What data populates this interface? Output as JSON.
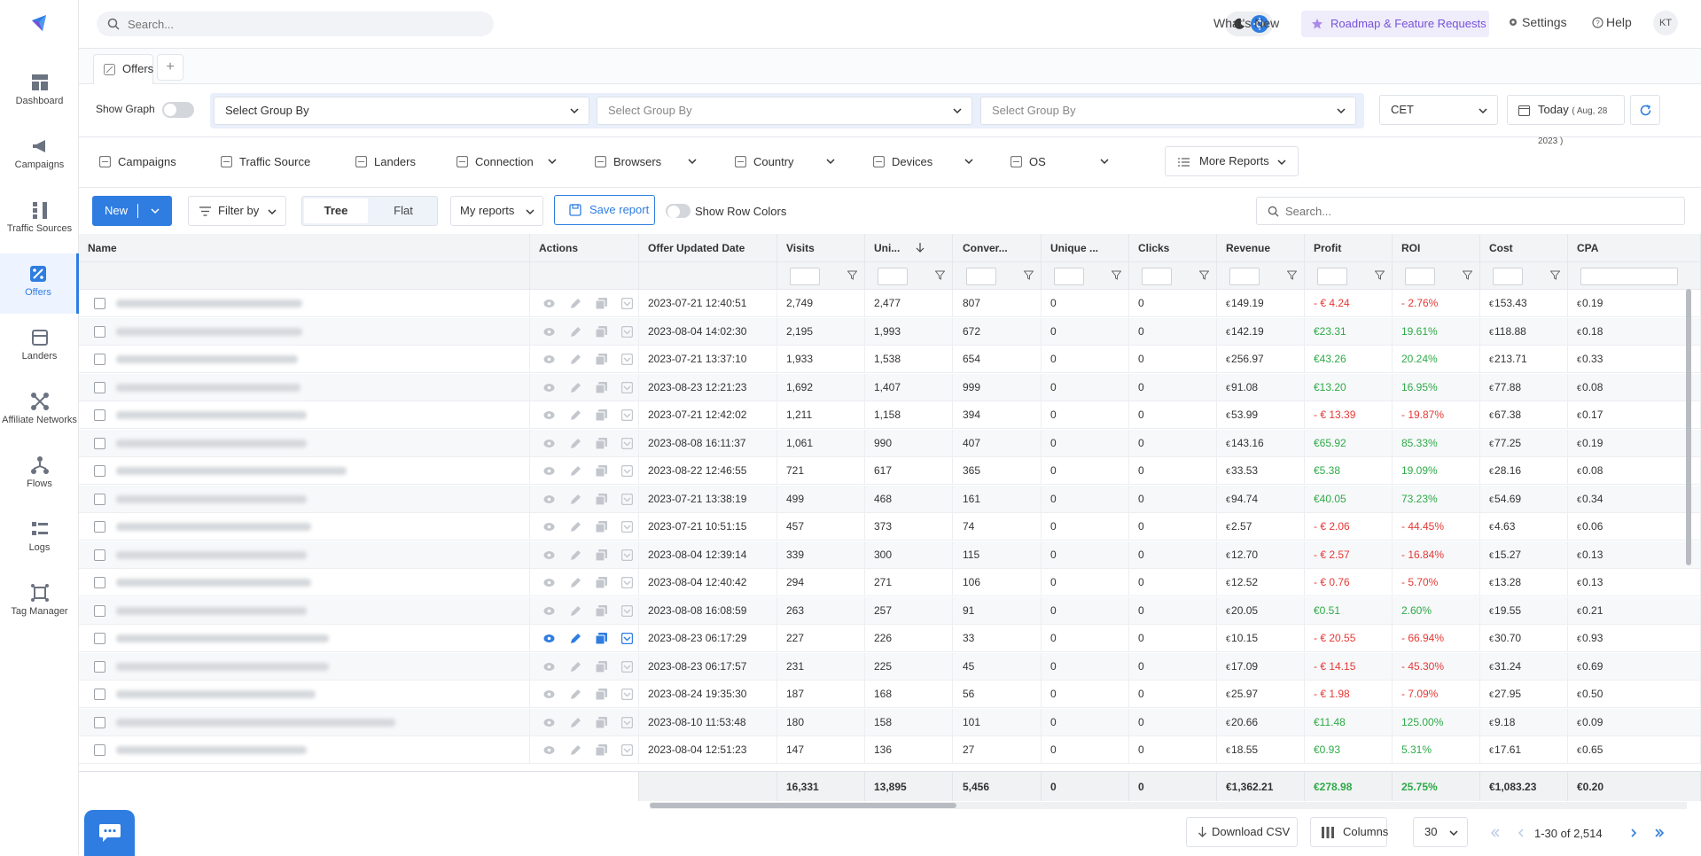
{
  "sidebar": {
    "items": [
      {
        "label": "Dashboard",
        "icon": "dashboard-icon"
      },
      {
        "label": "Campaigns",
        "icon": "megaphone-icon"
      },
      {
        "label": "Traffic Sources",
        "icon": "traffic-source-icon"
      },
      {
        "label": "Offers",
        "icon": "offer-percent-icon",
        "active": true
      },
      {
        "label": "Landers",
        "icon": "lander-icon"
      },
      {
        "label": "Affiliate Networks",
        "icon": "network-icon"
      },
      {
        "label": "Flows",
        "icon": "flow-icon"
      },
      {
        "label": "Logs",
        "icon": "logs-icon"
      },
      {
        "label": "Tag Manager",
        "icon": "tag-manager-icon"
      }
    ]
  },
  "topbar": {
    "search_placeholder": "Search...",
    "whats_new": "What's New",
    "roadmap": "Roadmap & Feature Requests",
    "settings": "Settings",
    "help": "Help",
    "avatar": "KT"
  },
  "tabs": {
    "active": "Offers",
    "add": "+"
  },
  "groupbar": {
    "show_graph": "Show Graph",
    "group1": "Select Group By",
    "group2": "Select Group By",
    "group3": "Select Group By",
    "timezone": "CET",
    "date_label": "Today",
    "date_value": "( Aug, 28 2023 )"
  },
  "reports": {
    "items": [
      "Campaigns",
      "Traffic Source",
      "Landers",
      "Connection",
      "Browsers",
      "Country",
      "Devices",
      "OS"
    ],
    "more": "More Reports"
  },
  "toolbar": {
    "new": "New",
    "filter": "Filter by",
    "tree": "Tree",
    "flat": "Flat",
    "my_reports": "My reports",
    "save_report": "Save report",
    "row_colors": "Show Row Colors",
    "search_placeholder": "Search..."
  },
  "grid": {
    "columns": [
      "Name",
      "Actions",
      "Offer Updated Date",
      "Visits",
      "Uni...",
      "Conver...",
      "Unique ...",
      "Clicks",
      "Revenue",
      "Profit",
      "ROI",
      "Cost",
      "CPA"
    ],
    "currency": "€",
    "rows": [
      {
        "date": "2023-07-21 12:40:51",
        "visits": "2,749",
        "uniq": "2,477",
        "conv": "807",
        "uc": "0",
        "clicks": "0",
        "revenue": "149.19",
        "profit": "- € 4.24",
        "roi": "- 2.76%",
        "cost": "153.43",
        "cpa": "0.19",
        "neg": true
      },
      {
        "date": "2023-08-04 14:02:30",
        "visits": "2,195",
        "uniq": "1,993",
        "conv": "672",
        "uc": "0",
        "clicks": "0",
        "revenue": "142.19",
        "profit": "€23.31",
        "roi": "19.61%",
        "cost": "118.88",
        "cpa": "0.18",
        "neg": false
      },
      {
        "date": "2023-07-21 13:37:10",
        "visits": "1,933",
        "uniq": "1,538",
        "conv": "654",
        "uc": "0",
        "clicks": "0",
        "revenue": "256.97",
        "profit": "€43.26",
        "roi": "20.24%",
        "cost": "213.71",
        "cpa": "0.33",
        "neg": false
      },
      {
        "date": "2023-08-23 12:21:23",
        "visits": "1,692",
        "uniq": "1,407",
        "conv": "999",
        "uc": "0",
        "clicks": "0",
        "revenue": "91.08",
        "profit": "€13.20",
        "roi": "16.95%",
        "cost": "77.88",
        "cpa": "0.08",
        "neg": false
      },
      {
        "date": "2023-07-21 12:42:02",
        "visits": "1,211",
        "uniq": "1,158",
        "conv": "394",
        "uc": "0",
        "clicks": "0",
        "revenue": "53.99",
        "profit": "- € 13.39",
        "roi": "- 19.87%",
        "cost": "67.38",
        "cpa": "0.17",
        "neg": true
      },
      {
        "date": "2023-08-08 16:11:37",
        "visits": "1,061",
        "uniq": "990",
        "conv": "407",
        "uc": "0",
        "clicks": "0",
        "revenue": "143.16",
        "profit": "€65.92",
        "roi": "85.33%",
        "cost": "77.25",
        "cpa": "0.19",
        "neg": false
      },
      {
        "date": "2023-08-22 12:46:55",
        "visits": "721",
        "uniq": "617",
        "conv": "365",
        "uc": "0",
        "clicks": "0",
        "revenue": "33.53",
        "profit": "€5.38",
        "roi": "19.09%",
        "cost": "28.16",
        "cpa": "0.08",
        "neg": false
      },
      {
        "date": "2023-07-21 13:38:19",
        "visits": "499",
        "uniq": "468",
        "conv": "161",
        "uc": "0",
        "clicks": "0",
        "revenue": "94.74",
        "profit": "€40.05",
        "roi": "73.23%",
        "cost": "54.69",
        "cpa": "0.34",
        "neg": false
      },
      {
        "date": "2023-07-21 10:51:15",
        "visits": "457",
        "uniq": "373",
        "conv": "74",
        "uc": "0",
        "clicks": "0",
        "revenue": "2.57",
        "profit": "- € 2.06",
        "roi": "- 44.45%",
        "cost": "4.63",
        "cpa": "0.06",
        "neg": true
      },
      {
        "date": "2023-08-04 12:39:14",
        "visits": "339",
        "uniq": "300",
        "conv": "115",
        "uc": "0",
        "clicks": "0",
        "revenue": "12.70",
        "profit": "- € 2.57",
        "roi": "- 16.84%",
        "cost": "15.27",
        "cpa": "0.13",
        "neg": true
      },
      {
        "date": "2023-08-04 12:40:42",
        "visits": "294",
        "uniq": "271",
        "conv": "106",
        "uc": "0",
        "clicks": "0",
        "revenue": "12.52",
        "profit": "- € 0.76",
        "roi": "- 5.70%",
        "cost": "13.28",
        "cpa": "0.13",
        "neg": true
      },
      {
        "date": "2023-08-08 16:08:59",
        "visits": "263",
        "uniq": "257",
        "conv": "91",
        "uc": "0",
        "clicks": "0",
        "revenue": "20.05",
        "profit": "€0.51",
        "roi": "2.60%",
        "cost": "19.55",
        "cpa": "0.21",
        "neg": false
      },
      {
        "date": "2023-08-23 06:17:29",
        "visits": "227",
        "uniq": "226",
        "conv": "33",
        "uc": "0",
        "clicks": "0",
        "revenue": "10.15",
        "profit": "- € 20.55",
        "roi": "- 66.94%",
        "cost": "30.70",
        "cpa": "0.93",
        "neg": true,
        "hover": true
      },
      {
        "date": "2023-08-23 06:17:57",
        "visits": "231",
        "uniq": "225",
        "conv": "45",
        "uc": "0",
        "clicks": "0",
        "revenue": "17.09",
        "profit": "- € 14.15",
        "roi": "- 45.30%",
        "cost": "31.24",
        "cpa": "0.69",
        "neg": true
      },
      {
        "date": "2023-08-24 19:35:30",
        "visits": "187",
        "uniq": "168",
        "conv": "56",
        "uc": "0",
        "clicks": "0",
        "revenue": "25.97",
        "profit": "- € 1.98",
        "roi": "- 7.09%",
        "cost": "27.95",
        "cpa": "0.50",
        "neg": true
      },
      {
        "date": "2023-08-10 11:53:48",
        "visits": "180",
        "uniq": "158",
        "conv": "101",
        "uc": "0",
        "clicks": "0",
        "revenue": "20.66",
        "profit": "€11.48",
        "roi": "125.00%",
        "cost": "9.18",
        "cpa": "0.09",
        "neg": false
      },
      {
        "date": "2023-08-04 12:51:23",
        "visits": "147",
        "uniq": "136",
        "conv": "27",
        "uc": "0",
        "clicks": "0",
        "revenue": "18.55",
        "profit": "€0.93",
        "roi": "5.31%",
        "cost": "17.61",
        "cpa": "0.65",
        "neg": false
      }
    ],
    "totals": {
      "visits": "16,331",
      "uniq": "13,895",
      "conv": "5,456",
      "uc": "0",
      "clicks": "0",
      "revenue": "€1,362.21",
      "profit": "€278.98",
      "roi": "25.75%",
      "cost": "€1,083.23",
      "cpa": "€0.20"
    }
  },
  "footer": {
    "download": "Download CSV",
    "columns": "Columns",
    "page_size": "30",
    "range": "1-30 of 2,514"
  },
  "colors": {
    "accent": "#2f7de1",
    "positive": "#2eaa47",
    "negative": "#e53935",
    "roadmap": "#7752d8"
  }
}
